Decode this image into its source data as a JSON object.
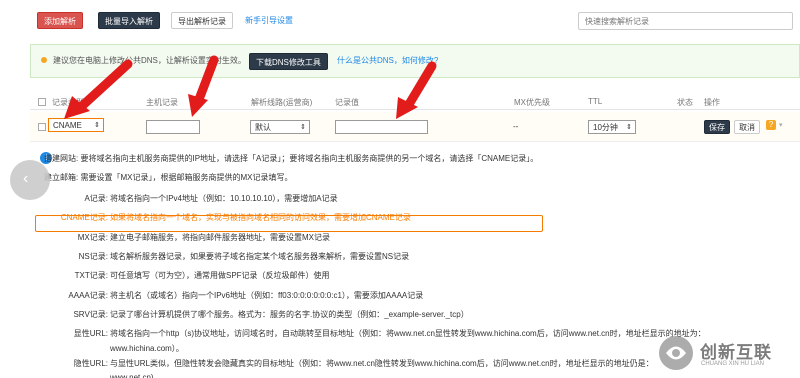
{
  "toolbar": {
    "add_label": "添加解析",
    "import_label": "批量导入解析",
    "export_label": "导出解析记录",
    "guide_label": "新手引导设置",
    "search_placeholder": "快速搜索解析记录"
  },
  "notice": {
    "text": "建议您在电脑上修改公共DNS，让解析设置实时生效。",
    "download_label": "下载DNS修改工具",
    "link1": "什么是公共DNS，如何修改?"
  },
  "table": {
    "headers": [
      "记录类型",
      "主机记录",
      "解析线路(运营商)",
      "记录值",
      "MX优先级",
      "TTL",
      "状态",
      "操作"
    ],
    "row": {
      "type": "CNAME",
      "line": "默认",
      "mx": "--",
      "ttl": "10分钟",
      "save_label": "保存",
      "cancel_label": "取消",
      "help_label": "?"
    }
  },
  "help": {
    "intro": [
      {
        "label": "搭建网站:",
        "text": "要将域名指向主机服务商提供的IP地址，请选择「A记录」；要将域名指向主机服务商提供的另一个域名，请选择「CNAME记录」。"
      },
      {
        "label": "建立邮箱:",
        "text": "需要设置「MX记录」，根据邮箱服务商提供的MX记录填写。"
      }
    ],
    "records": [
      {
        "label": "A记录:",
        "text": "将域名指向一个IPv4地址（例如：10.10.10.10），需要增加A记录"
      },
      {
        "label": "CNAME记录:",
        "text": "如果将域名指向一个域名，实现与被指向域名相同的访问效果，需要增加CNAME记录"
      },
      {
        "label": "MX记录:",
        "text": "建立电子邮箱服务，将指向邮件服务器地址，需要设置MX记录"
      },
      {
        "label": "NS记录:",
        "text": "域名解析服务器记录，如果要将子域名指定某个域名服务器来解析，需要设置NS记录"
      },
      {
        "label": "TXT记录:",
        "text": "可任意填写（可为空），通常用做SPF记录（反垃圾邮件）使用"
      },
      {
        "label": "AAAA记录:",
        "text": "将主机名（或域名）指向一个IPv6地址（例如：ff03:0:0:0:0:0:0:c1），需要添加AAAA记录"
      },
      {
        "label": "SRV记录:",
        "text": "记录了哪台计算机提供了哪个服务。格式为：服务的名字.协议的类型（例如：_example-server._tcp）"
      },
      {
        "label": "显性URL:",
        "text": "将域名指向一个http（s)协议地址，访问域名时，自动跳转至目标地址（例如：将www.net.cn显性转发到www.hichina.com后，访问www.net.cn时，地址栏显示的地址为："
      },
      {
        "label": "",
        "text": "www.hichina.com）。"
      },
      {
        "label": "隐性URL:",
        "text": "与显性URL类似，但隐性转发会隐藏真实的目标地址（例如：将www.net.cn隐性转发到www.hichina.com后，访问www.net.cn时，地址栏显示的地址仍是："
      },
      {
        "label": "",
        "text": "www.net.cn)。"
      }
    ]
  },
  "watermark": {
    "title": "创新互联",
    "sub": "CHUANG XIN HU LIAN"
  },
  "colors": {
    "primary_red": "#d9534f",
    "dark_button": "#2d3a4a",
    "link_blue": "#1e88e5",
    "highlight_orange": "#f57c00",
    "arrow_red": "#e21b1b"
  }
}
